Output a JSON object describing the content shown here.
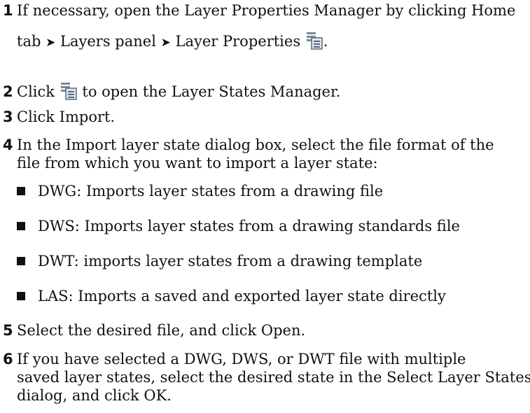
{
  "steps": [
    {
      "num": "1",
      "line1": "If necessary, open the Layer Properties Manager by clicking Home",
      "line2_a": "tab",
      "arrow": "➤",
      "line2_b": "Layers panel",
      "line2_c": "Layer Properties",
      "line2_end": ".",
      "icon": "layer-properties-icon"
    },
    {
      "num": "2",
      "pre": "Click",
      "post": "to open the Layer States Manager.",
      "icon": "layer-states-icon"
    },
    {
      "num": "3",
      "text": "Click Import."
    },
    {
      "num": "4",
      "line1": "In the Import layer state dialog box, select the file format of the",
      "line2": "file from which you want to import a layer state:"
    },
    {
      "num": "5",
      "text": "Select the desired file, and click Open."
    },
    {
      "num": "6",
      "line1": "If you have selected a DWG, DWS, or DWT file with multiple",
      "line2": "saved layer states, select the desired state in the Select Layer States",
      "line3": "dialog, and click OK."
    }
  ],
  "bullets": [
    "DWG: Imports layer states from a drawing file",
    "DWS: Imports layer states from a drawing standards file",
    "DWT: imports layer states from a drawing template",
    "LAS: Imports a saved and exported layer state directly"
  ]
}
